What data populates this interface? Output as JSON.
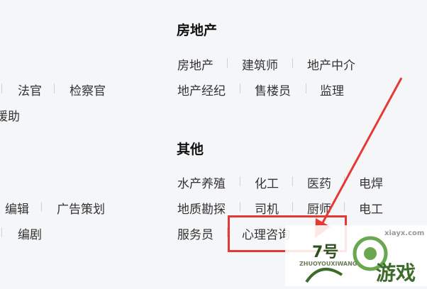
{
  "left_column": {
    "row1": {
      "faguan": "法官",
      "jianchaguan": "检察官"
    },
    "row2_partial": "援助",
    "row3": {
      "bianji": "编辑",
      "guanggao": "广告策划"
    },
    "row4": {
      "bianju": "编剧"
    }
  },
  "real_estate": {
    "title": "房地产",
    "items": [
      "房地产",
      "建筑师",
      "地产中介",
      "地产经纪",
      "售楼员",
      "监理"
    ]
  },
  "other": {
    "title": "其他",
    "items": [
      "水产养殖",
      "化工",
      "医药",
      "电焊",
      "地质勘探",
      "司机",
      "厨师",
      "电工",
      "服务员",
      "心理咨询"
    ]
  },
  "annotation": {
    "color": "#e53935"
  },
  "watermark": {
    "brand": "游戏",
    "sub": "ZHUOYOUXIWANG",
    "num": "7号",
    "url": "xiayx.com"
  }
}
